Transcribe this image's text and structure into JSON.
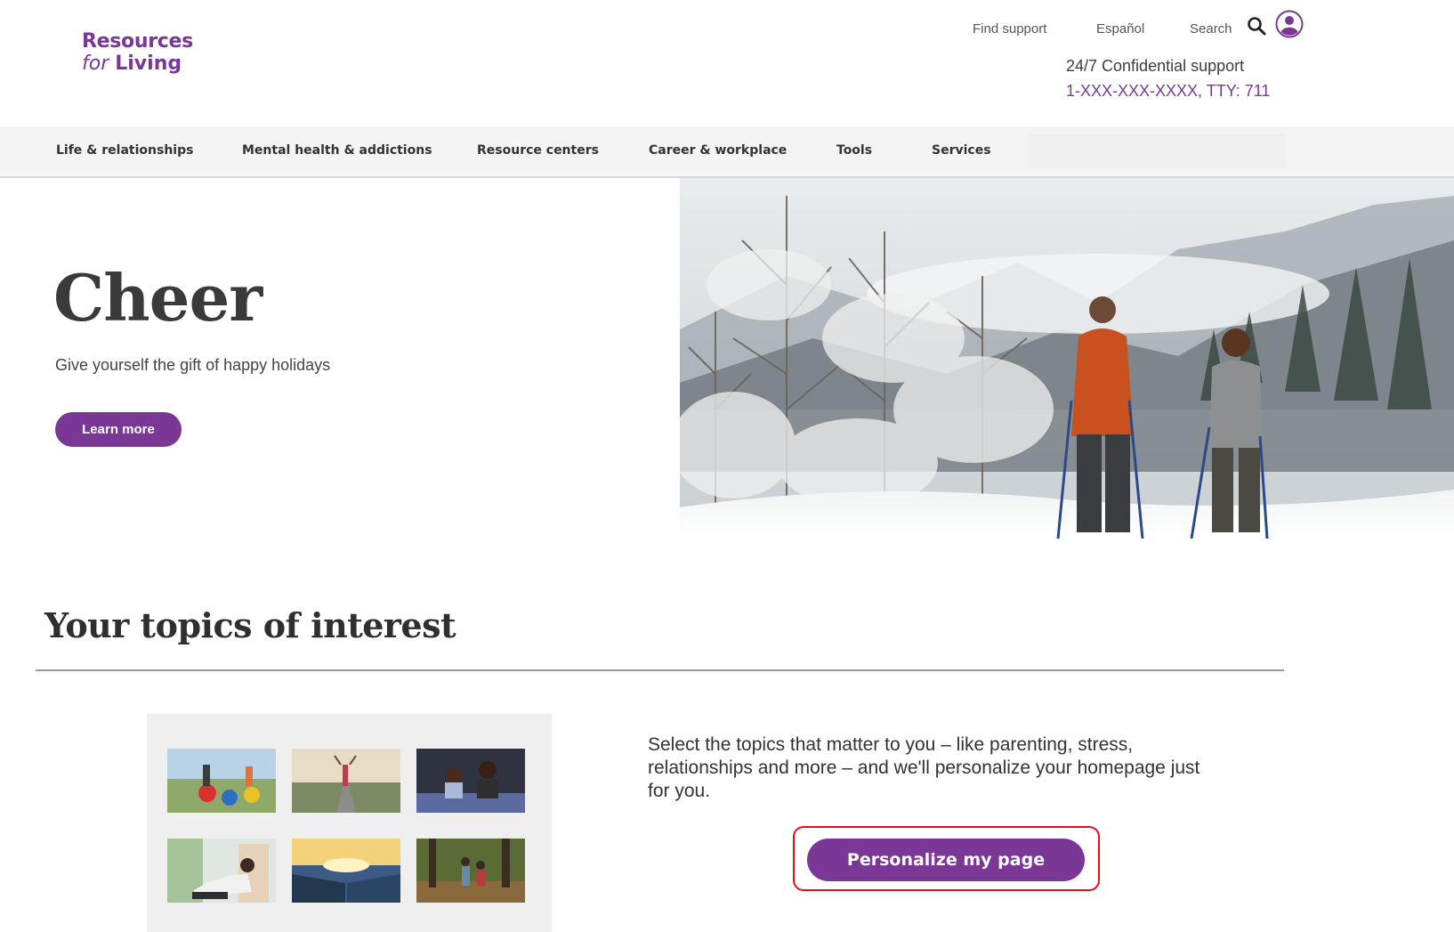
{
  "logo": {
    "line1": "Resources",
    "for": "for",
    "living": "Living"
  },
  "utility_nav": {
    "find_support": "Find support",
    "espanol": "Español",
    "search": "Search",
    "icons": [
      "search-icon",
      "user-icon"
    ]
  },
  "support": {
    "label": "24/7 Confidential support",
    "phone": "1-XXX-XXX-XXXX, TTY: 711"
  },
  "main_nav": {
    "items": [
      {
        "label": "Life & relationships"
      },
      {
        "label": "Mental health & addictions"
      },
      {
        "label": "Resource centers"
      },
      {
        "label": "Career & workplace"
      },
      {
        "label": "Tools"
      },
      {
        "label": "Services"
      }
    ]
  },
  "hero": {
    "title": "Cheer",
    "subtitle": "Give yourself the gift of happy holidays",
    "button": "Learn more"
  },
  "topics": {
    "title": "Your topics of interest",
    "description": "Select the topics that matter to you – like parenting, stress, relationships and more – and we'll personalize your homepage just for you.",
    "button": "Personalize my page"
  },
  "colors": {
    "brand_purple": "#7b3796",
    "highlight_red": "#e3101f"
  }
}
